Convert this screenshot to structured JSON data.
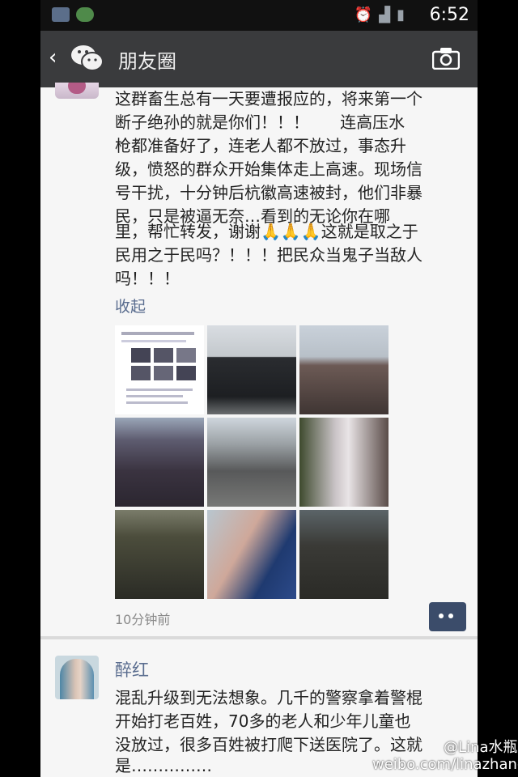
{
  "status_bar": {
    "time": "6:52",
    "icons": [
      "shield-icon",
      "wechat-icon",
      "alarm-icon",
      "signal-icon",
      "battery-icon"
    ]
  },
  "title_bar": {
    "back_glyph": "‹",
    "title": "朋友圈",
    "camera_icon": "camera-icon"
  },
  "post1": {
    "lines": [
      "这群畜生总有一天要遭报应的，将来第一个",
      "断子绝孙的就是你们！！！      连高压水",
      "枪都准备好了，连老人都不放过，事态升",
      "级，愤怒的群众开始集体走上高速。现场信",
      "号干扰，十分钟后杭徽高速被封，他们非暴",
      "民，只是被逼无奈…看到的无论你在哪"
    ],
    "lines2": [
      "里，帮忙转发，谢谢🙏🙏🙏这就是取之于",
      "民用之于民吗？！！！把民众当鬼子当敌人",
      "吗！！！"
    ],
    "collapse": "收起",
    "time": "10分钟前"
  },
  "post2": {
    "name": "醉红",
    "lines": [
      "混乱升级到无法想象。几千的警察拿着警棍",
      "开始打老百姓，70多的老人和少年儿童也",
      "没放过，很多百姓被打爬下送医院了。这就",
      "是……………"
    ]
  },
  "watermark": {
    "handle": "@Lina水瓶",
    "url": "weibo.com/linazhang"
  },
  "colors": {
    "title_bar": "#3a3b3d",
    "link_blue": "#5a6d8f",
    "background": "#f6f6f6"
  }
}
